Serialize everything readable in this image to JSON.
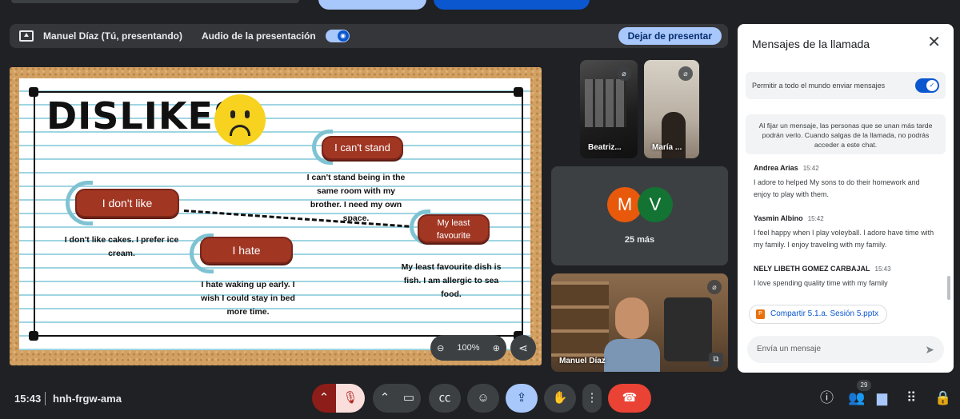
{
  "presentation_bar": {
    "presenter": "Manuel Díaz (Tú, presentando)",
    "audio_label": "Audio de la presentación",
    "stop_button": "Dejar de presentar"
  },
  "slide": {
    "title": "DISLIKES",
    "tags": {
      "dont_like": "I don't like",
      "cant_stand": "I can't stand",
      "hate": "I hate",
      "least_fav_1": "My least",
      "least_fav_2": "favourite"
    },
    "texts": {
      "dont_like": "I don't like cakes. I prefer ice cream.",
      "cant_stand": "I can't stand being in the same room with my brother. I need my own space.",
      "hate": "I hate waking up early. I wish I could stay in bed more time.",
      "least_fav": "My least favourite dish is fish. I am allergic to sea food."
    },
    "zoom": "100%"
  },
  "participants": {
    "beatriz": "Beatriz...",
    "maria": "María ...",
    "avatar_m": "M",
    "avatar_v": "V",
    "more": "25 más",
    "manuel": "Manuel Díaz"
  },
  "chat": {
    "header": "Mensajes de la llamada",
    "permission": "Permitir a todo el mundo enviar mensajes",
    "pin_note": "Al fijar un mensaje, las personas que se unan más tarde podrán verlo. Cuando salgas de la llamada, no podrás acceder a este chat.",
    "messages": [
      {
        "author": "Andrea Arias",
        "time": "15:42",
        "text": "I adore to helped My sons to do their homework and enjoy to play with them."
      },
      {
        "author": "Yasmin Albino",
        "time": "15:42",
        "text": "I feel happy when I play voleyball. I adore have time with my family. I enjoy  traveling with my family."
      },
      {
        "author": "NELY LIBETH GOMEZ CARBAJAL",
        "time": "15:43",
        "text": "I love spending quality time with my family"
      }
    ],
    "file_chip": "Compartir 5.1.a. Sesión 5.pptx",
    "input_placeholder": "Envía un mensaje"
  },
  "bottom": {
    "time": "15:43",
    "meeting_code": "hnh-frgw-ama",
    "participants_count": "29"
  },
  "colors": {
    "bg": "#202124",
    "accent": "#a8c7fa",
    "primary": "#0b57d0",
    "end_call": "#ea4335",
    "tag_red": "#a13623"
  }
}
